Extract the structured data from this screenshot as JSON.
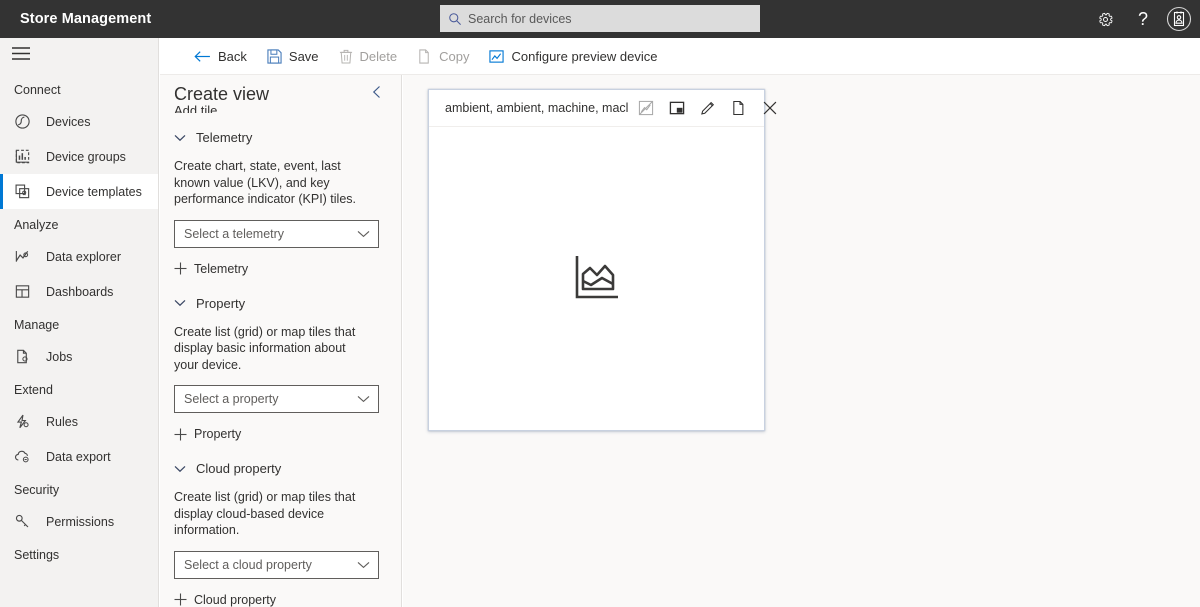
{
  "topbar": {
    "app_title": "Store Management",
    "search": {
      "placeholder": "Search for devices",
      "value": "",
      "icon": "search-icon"
    },
    "actions": [
      {
        "name": "settings-icon",
        "label": "Settings"
      },
      {
        "name": "help-icon",
        "label": "Help"
      },
      {
        "name": "account-icon",
        "label": "Account"
      }
    ]
  },
  "sidebar": {
    "menu_icon": "hamburger-icon",
    "groups": [
      {
        "label": "Connect",
        "items": [
          {
            "label": "Devices",
            "icon": "devices-icon",
            "selected": false
          },
          {
            "label": "Device groups",
            "icon": "device-groups-icon",
            "selected": false
          },
          {
            "label": "Device templates",
            "icon": "device-templates-icon",
            "selected": true
          }
        ]
      },
      {
        "label": "Analyze",
        "items": [
          {
            "label": "Data explorer",
            "icon": "data-explorer-icon",
            "selected": false
          },
          {
            "label": "Dashboards",
            "icon": "dashboards-icon",
            "selected": false
          }
        ]
      },
      {
        "label": "Manage",
        "items": [
          {
            "label": "Jobs",
            "icon": "jobs-icon",
            "selected": false
          }
        ]
      },
      {
        "label": "Extend",
        "items": [
          {
            "label": "Rules",
            "icon": "rules-icon",
            "selected": false
          },
          {
            "label": "Data export",
            "icon": "data-export-icon",
            "selected": false
          }
        ]
      },
      {
        "label": "Security",
        "items": [
          {
            "label": "Permissions",
            "icon": "permissions-icon",
            "selected": false
          }
        ]
      },
      {
        "label": "Settings",
        "items": []
      }
    ]
  },
  "commandbar": {
    "items": [
      {
        "label": "Back",
        "icon": "back-arrow-icon",
        "disabled": false
      },
      {
        "label": "Save",
        "icon": "save-icon",
        "disabled": false
      },
      {
        "label": "Delete",
        "icon": "trash-icon",
        "disabled": true
      },
      {
        "label": "Copy",
        "icon": "copy-icon",
        "disabled": true
      },
      {
        "label": "Configure preview device",
        "icon": "preview-device-icon",
        "disabled": false
      }
    ]
  },
  "panel": {
    "title": "Create view",
    "collapse_icon": "chevron-left-icon",
    "clipped_label": "Add tile",
    "sections": [
      {
        "title": "Telemetry",
        "description": "Create chart, state, event, last known value (LKV), and key performance indicator (KPI) tiles.",
        "dropdown_placeholder": "Select a telemetry",
        "add_label": "Telemetry"
      },
      {
        "title": "Property",
        "description": "Create list (grid) or map tiles that display basic information about your device.",
        "dropdown_placeholder": "Select a property",
        "add_label": "Property"
      },
      {
        "title": "Cloud property",
        "description": "Create list (grid) or map tiles that display cloud-based device information.",
        "dropdown_placeholder": "Select a cloud property",
        "add_label": "Cloud property"
      }
    ]
  },
  "canvas": {
    "tile": {
      "title": "ambient, ambient, machine, macl",
      "placeholder_icon": "area-chart-icon",
      "actions": [
        {
          "name": "chart-type-icon",
          "label": "Change visualization",
          "disabled": true
        },
        {
          "name": "resize-tile-icon",
          "label": "Resize"
        },
        {
          "name": "edit-pencil-icon",
          "label": "Edit"
        },
        {
          "name": "copy-tile-icon",
          "label": "Copy"
        },
        {
          "name": "close-tile-icon",
          "label": "Delete"
        }
      ]
    }
  },
  "colors": {
    "topbar_bg": "#333333",
    "accent": "#0078d4",
    "sidebar_bg": "#f3f2f1",
    "canvas_bg": "#faf9f8",
    "text": "#323130",
    "disabled_text": "#a19f9d"
  }
}
